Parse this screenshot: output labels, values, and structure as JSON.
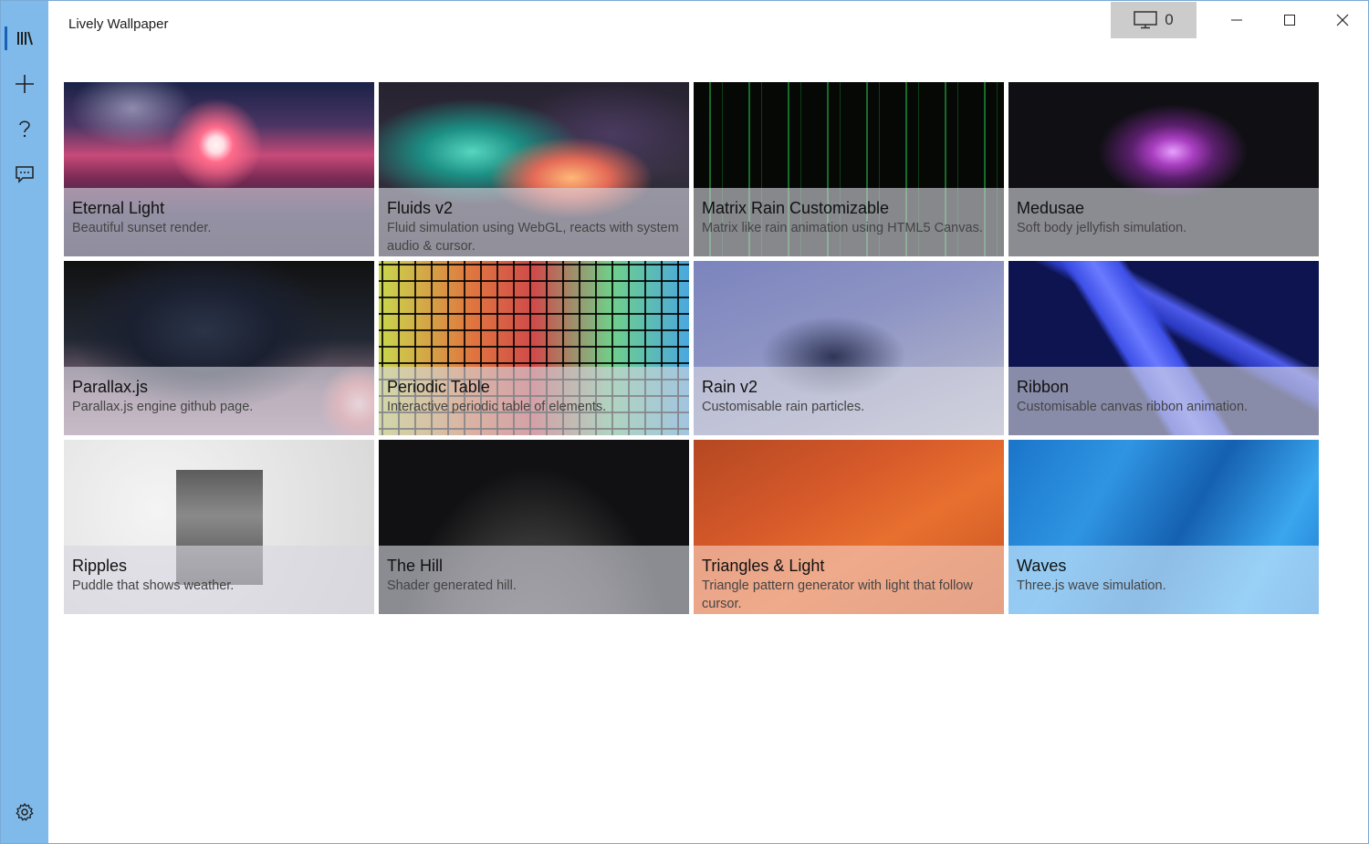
{
  "app": {
    "title": "Lively Wallpaper"
  },
  "titlebar": {
    "monitor_count": "0"
  },
  "sidebar": {
    "items": [
      {
        "icon": "library-icon"
      },
      {
        "icon": "add-icon"
      },
      {
        "icon": "help-icon"
      },
      {
        "icon": "feedback-icon"
      },
      {
        "icon": "gear-icon"
      }
    ]
  },
  "wallpapers": [
    {
      "name": "Eternal Light",
      "desc": "Beautiful sunset render."
    },
    {
      "name": "Fluids v2",
      "desc": "Fluid simulation using WebGL, reacts with system audio & cursor."
    },
    {
      "name": "Matrix Rain Customizable",
      "desc": "Matrix like rain animation using HTML5 Canvas."
    },
    {
      "name": "Medusae",
      "desc": "Soft body jellyfish simulation."
    },
    {
      "name": "Parallax.js",
      "desc": "Parallax.js engine github page."
    },
    {
      "name": "Periodic Table",
      "desc": "Interactive periodic table of elements."
    },
    {
      "name": "Rain v2",
      "desc": "Customisable rain particles."
    },
    {
      "name": "Ribbon",
      "desc": "Customisable canvas ribbon animation."
    },
    {
      "name": "Ripples",
      "desc": "Puddle that shows weather."
    },
    {
      "name": "The Hill",
      "desc": "Shader generated hill."
    },
    {
      "name": "Triangles & Light",
      "desc": "Triangle pattern generator with light that follow cursor."
    },
    {
      "name": "Waves",
      "desc": "Three.js wave simulation."
    }
  ],
  "colors": {
    "sidebar": "#80baea",
    "accent": "#1a5fb4"
  }
}
